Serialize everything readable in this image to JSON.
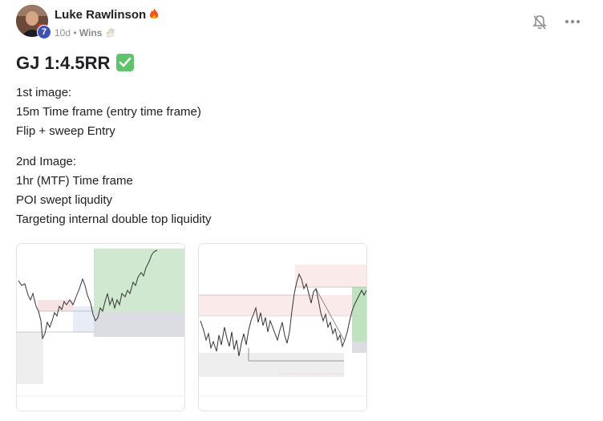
{
  "post": {
    "author": "Luke Rawlinson",
    "level": "7",
    "time_ago": "10d",
    "separator": "•",
    "category": "Wins",
    "title": "GJ 1:4.5RR",
    "body": {
      "paragraph1": [
        "1st image:",
        "15m Time frame (entry time frame)",
        "Flip + sweep Entry"
      ],
      "paragraph2": [
        "2nd Image:",
        "1hr (MTF) Time frame",
        "POI swept liqudity",
        "Targeting internal double top liquidity"
      ]
    }
  },
  "icons": {
    "author_badge": "fire-icon",
    "category_badge": "clapping-hands-icon",
    "title_badge": "check-mark-button-icon",
    "notify": "bell-icon",
    "menu": "more-dots-icon"
  },
  "colors": {
    "level_badge": "#3f51b5",
    "check_badge": "#5ec36a",
    "chart_profit_zone": "#cfe8cf",
    "chart_loss_zone": "#dcdde3"
  }
}
